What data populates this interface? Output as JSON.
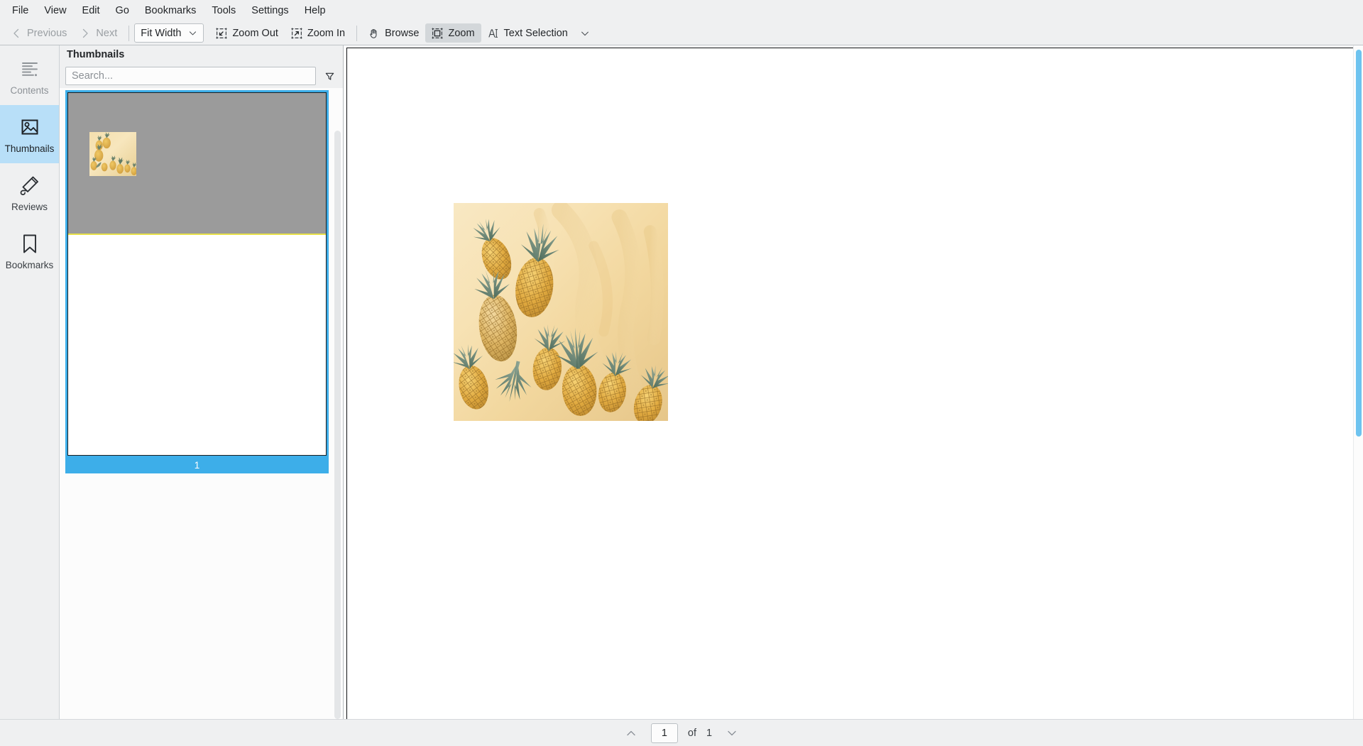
{
  "menubar": {
    "items": [
      {
        "label": "File"
      },
      {
        "label": "View"
      },
      {
        "label": "Edit"
      },
      {
        "label": "Go"
      },
      {
        "label": "Bookmarks"
      },
      {
        "label": "Tools"
      },
      {
        "label": "Settings"
      },
      {
        "label": "Help"
      }
    ]
  },
  "toolbar": {
    "previous_label": "Previous",
    "next_label": "Next",
    "zoom_mode_value": "Fit Width",
    "zoom_out_label": "Zoom Out",
    "zoom_in_label": "Zoom In",
    "browse_label": "Browse",
    "zoom_label": "Zoom",
    "text_selection_label": "Text Selection"
  },
  "rail": {
    "items": [
      {
        "label": "Contents",
        "icon": "contents-icon",
        "state": "disabled"
      },
      {
        "label": "Thumbnails",
        "icon": "thumbnails-icon",
        "state": "selected"
      },
      {
        "label": "Reviews",
        "icon": "reviews-icon",
        "state": "normal"
      },
      {
        "label": "Bookmarks",
        "icon": "bookmarks-icon",
        "state": "normal"
      }
    ]
  },
  "thumbnails_panel": {
    "title": "Thumbnails",
    "search_placeholder": "Search...",
    "search_value": "",
    "filter_icon": "filter-funnel-icon",
    "pages": [
      {
        "number": "1",
        "selected": true
      }
    ]
  },
  "document": {
    "page_content": "photograph of ripe pineapples scattered on a pale yellow painted surface"
  },
  "statusbar": {
    "prev_page_icon": "chevron-up-icon",
    "current_page": "1",
    "of_label": "of",
    "total_pages": "1",
    "next_page_icon": "chevron-down-icon"
  },
  "colors": {
    "accent": "#3daee9",
    "chrome": "#eff0f1",
    "selection_text": "#ffffff",
    "thumb_highlight": "#e8e14a"
  }
}
